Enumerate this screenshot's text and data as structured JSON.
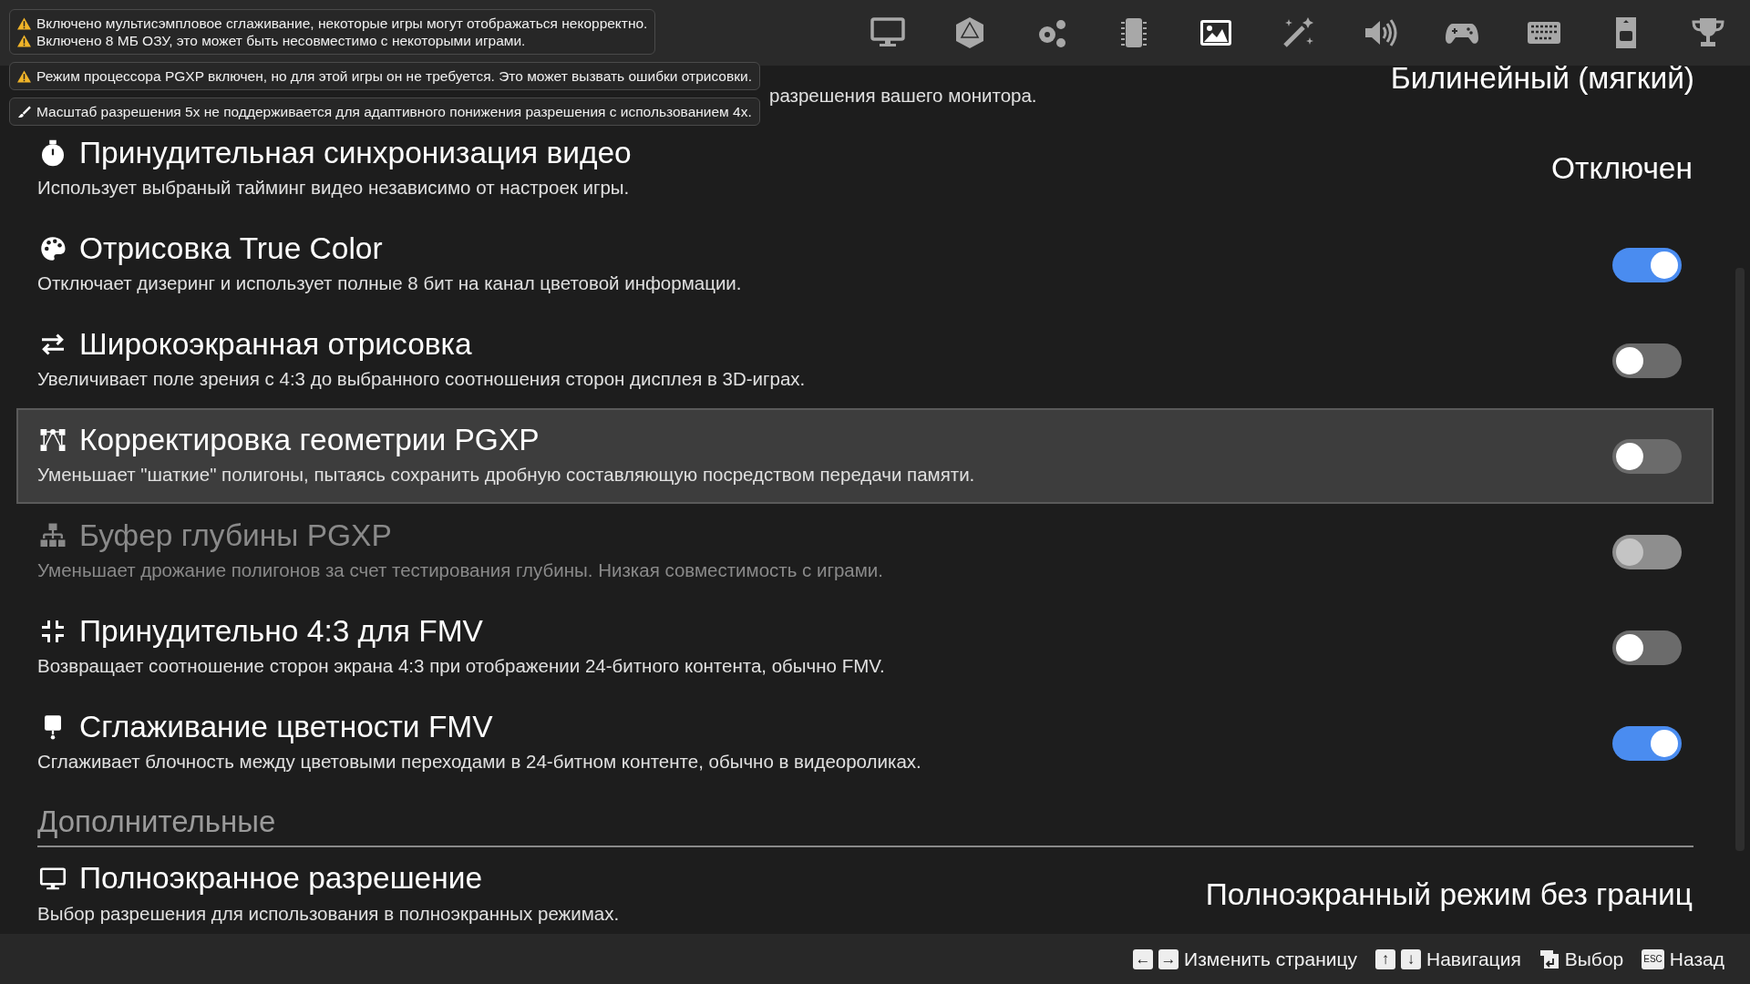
{
  "tabs": [
    {
      "selected": false
    },
    {
      "selected": false
    },
    {
      "selected": false
    },
    {
      "selected": false
    },
    {
      "selected": true
    },
    {
      "selected": false
    },
    {
      "selected": false
    },
    {
      "selected": false
    },
    {
      "selected": false
    },
    {
      "selected": false
    },
    {
      "selected": false
    }
  ],
  "notifications": [
    {
      "kind": "warning",
      "lines": [
        "Включено мультисэмпловое сглаживание, некоторые игры могут отображаться некорректно.",
        "Включено 8 МБ ОЗУ, это может быть несовместимо с некоторыми играми."
      ]
    },
    {
      "kind": "warning",
      "lines": [
        "Режим процессора PGXP включен, но для этой игры он не требуется. Это может вызвать ошибки отрисовки."
      ]
    },
    {
      "kind": "info",
      "lines": [
        "Масштаб разрешения 5x не поддерживается для адаптивного понижения разрешения с использованием 4x."
      ]
    }
  ],
  "partial_row": {
    "description_tail": "разрешения вашего монитора.",
    "value": "Билинейный (мягкий)"
  },
  "settings": [
    {
      "kind": "value",
      "title": "Принудительная синхронизация видео",
      "description": "Использует выбраный тайминг видео независимо от настроек игры.",
      "value": "Отключен",
      "disabled": false,
      "selected": false
    },
    {
      "kind": "toggle",
      "title": "Отрисовка True Color",
      "description": "Отключает дизеринг и использует полные 8 бит на канал цветовой информации.",
      "on": true,
      "disabled": false,
      "selected": false
    },
    {
      "kind": "toggle",
      "title": "Широкоэкранная отрисовка",
      "description": "Увеличивает поле зрения с 4:3 до выбранного соотношения сторон дисплея в 3D-играх.",
      "on": false,
      "disabled": false,
      "selected": false
    },
    {
      "kind": "toggle",
      "title": "Корректировка геометрии PGXP",
      "description": "Уменьшает \"шаткие\" полигоны, пытаясь сохранить дробную составляющую посредством передачи памяти.",
      "on": false,
      "disabled": false,
      "selected": true
    },
    {
      "kind": "toggle",
      "title": "Буфер глубины PGXP",
      "description": "Уменьшает дрожание полигонов за счет тестирования глубины. Низкая совместимость с играми.",
      "on": false,
      "disabled": true,
      "selected": false
    },
    {
      "kind": "toggle",
      "title": "Принудительно 4:3 для FMV",
      "description": "Возвращает соотношение сторон экрана 4:3 при отображении 24-битного контента, обычно FMV.",
      "on": false,
      "disabled": false,
      "selected": false
    },
    {
      "kind": "toggle",
      "title": "Сглаживание цветности FMV",
      "description": "Сглаживает блочность между цветовыми переходами в 24-битном контенте, обычно в видеороликах.",
      "on": true,
      "disabled": false,
      "selected": false
    },
    {
      "kind": "header",
      "title": "Дополнительные"
    },
    {
      "kind": "value",
      "title": "Полноэкранное разрешение",
      "description": "Выбор разрешения для использования в полноэкранных режимах.",
      "value": "Полноэкранный режим без границ",
      "disabled": false,
      "selected": false
    }
  ],
  "hints": [
    {
      "keys": [
        {
          "kind": "arrow",
          "label": "←"
        },
        {
          "kind": "arrow",
          "label": "→"
        }
      ],
      "text": "Изменить страницу"
    },
    {
      "keys": [
        {
          "kind": "arrow",
          "label": "↑"
        },
        {
          "kind": "arrow",
          "label": "↓"
        }
      ],
      "text": "Навигация"
    },
    {
      "keys": [
        {
          "kind": "enter"
        }
      ],
      "text": "Выбор"
    },
    {
      "keys": [
        {
          "kind": "word",
          "label": "ESC"
        }
      ],
      "text": "Назад"
    }
  ]
}
